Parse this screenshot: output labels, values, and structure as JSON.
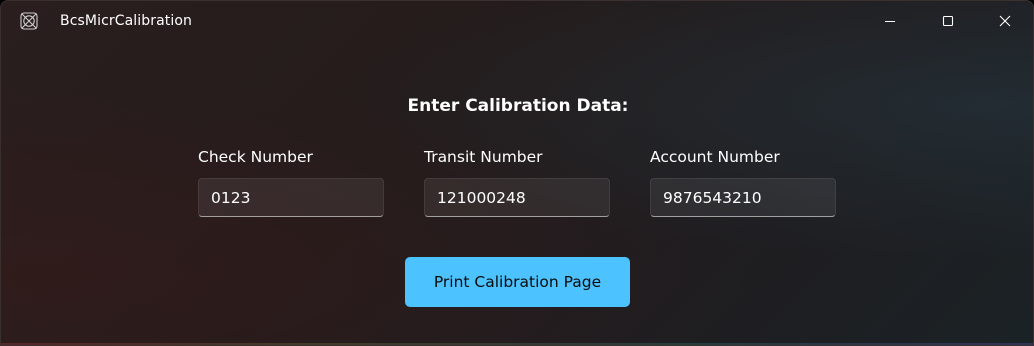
{
  "window": {
    "title": "BcsMicrCalibration",
    "app_icon": "app-placeholder-icon",
    "caption_buttons": [
      "minimize-icon",
      "maximize-icon",
      "close-icon"
    ]
  },
  "form": {
    "heading": "Enter Calibration Data:",
    "fields": [
      {
        "label": "Check Number",
        "value": "0123"
      },
      {
        "label": "Transit Number",
        "value": "121000248"
      },
      {
        "label": "Account Number",
        "value": "9876543210"
      }
    ],
    "print_button_label": "Print Calibration Page"
  },
  "colors": {
    "accent": "#4cc2ff",
    "accent_text": "#0b0b0b",
    "text": "#ffffff"
  }
}
